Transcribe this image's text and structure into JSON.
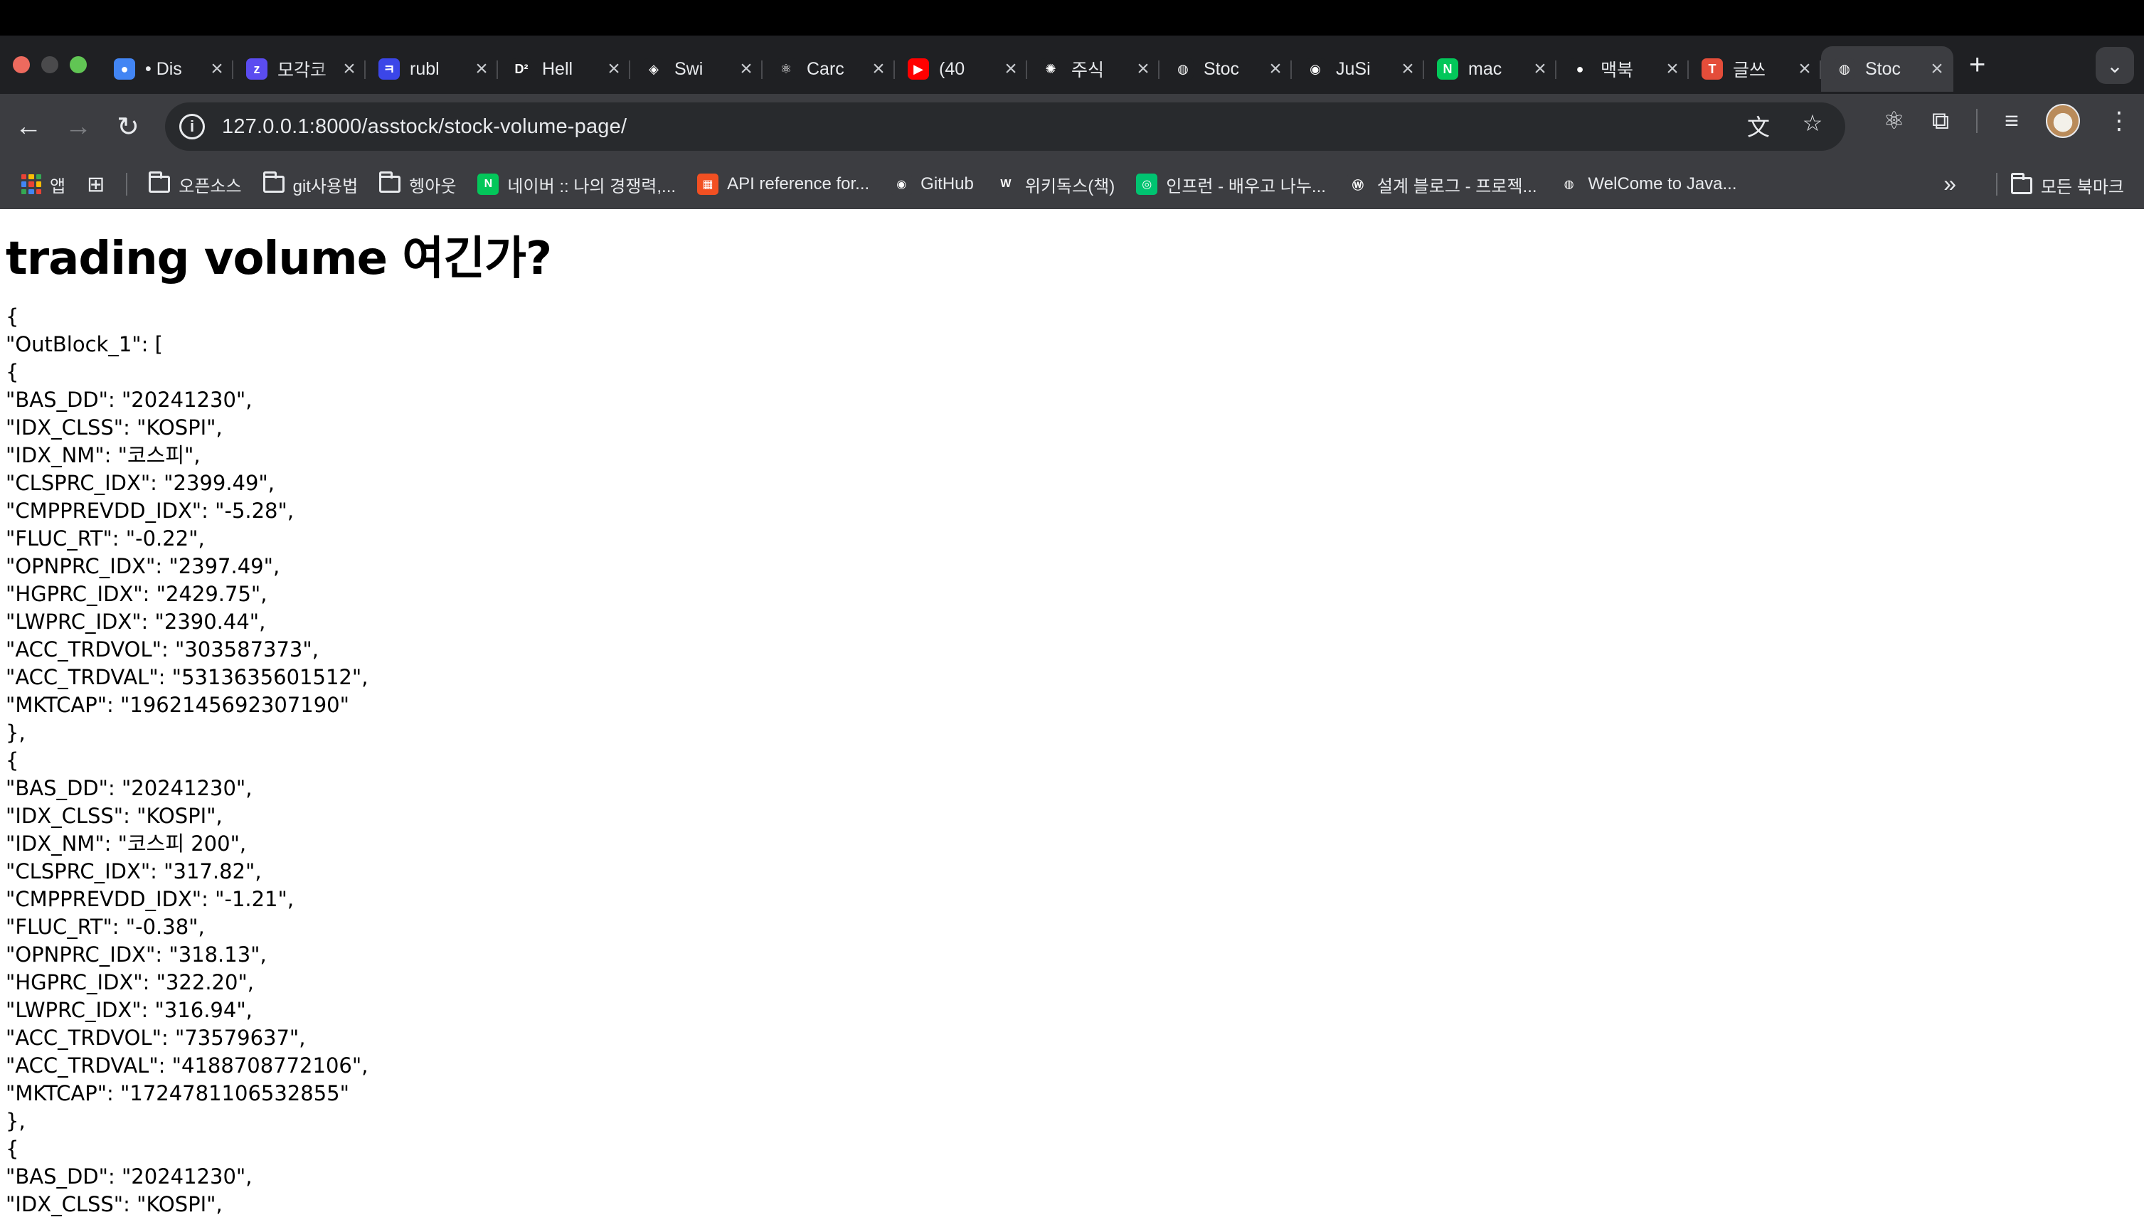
{
  "browser": {
    "tabs": [
      {
        "title": "• Dis",
        "icon": "chrome-icon",
        "color": "#4285f4",
        "glyph": "●"
      },
      {
        "title": "모각코",
        "icon": "zoom-icon",
        "color": "#5b4cf0",
        "glyph": "z"
      },
      {
        "title": "rubl",
        "icon": "rubl-icon",
        "color": "#3b46e8",
        "glyph": "ㅋ"
      },
      {
        "title": "Hell",
        "icon": "d2-icon",
        "color": "#1f2023",
        "glyph": "D²"
      },
      {
        "title": "Swi",
        "icon": "swiper-icon",
        "color": "#1f2023",
        "glyph": "◈"
      },
      {
        "title": "Carc",
        "icon": "react-icon",
        "color": "#1f2023",
        "glyph": "⚛"
      },
      {
        "title": "(40",
        "icon": "youtube-icon",
        "color": "#ff0000",
        "glyph": "▶"
      },
      {
        "title": "주식",
        "icon": "openai-icon",
        "color": "#1f2023",
        "glyph": "✺"
      },
      {
        "title": "Stoc",
        "icon": "globe-icon",
        "color": "#1f2023",
        "glyph": "◍"
      },
      {
        "title": "JuSi",
        "icon": "github-icon",
        "color": "#1f2023",
        "glyph": "◉"
      },
      {
        "title": "mac",
        "icon": "naver-icon",
        "color": "#03c75a",
        "glyph": "N"
      },
      {
        "title": "맥북",
        "icon": "apple-icon",
        "color": "#1f2023",
        "glyph": "●"
      },
      {
        "title": "글쓰",
        "icon": "pin-icon",
        "color": "#e44d3a",
        "glyph": "T"
      },
      {
        "title": "Stoc",
        "icon": "globe-icon",
        "color": "#3c3d41",
        "glyph": "◍",
        "active": true
      }
    ],
    "new_tab": "+",
    "tab_search": "⌄",
    "url": "127.0.0.1:8000/asstock/stock-volume-page/",
    "bookmarks": [
      {
        "label": "앱",
        "type": "apps"
      },
      {
        "label": "",
        "type": "grid"
      },
      {
        "label": "오픈소스",
        "type": "folder"
      },
      {
        "label": "git사용법",
        "type": "folder"
      },
      {
        "label": "헹아웃",
        "type": "folder"
      },
      {
        "label": "네이버 :: 나의 경쟁력,...",
        "type": "site",
        "color": "#03c75a",
        "glyph": "N"
      },
      {
        "label": "API reference for...",
        "type": "site",
        "color": "#f25022",
        "glyph": "▦"
      },
      {
        "label": "GitHub",
        "type": "site",
        "color": "#3c3d41",
        "glyph": "◉"
      },
      {
        "label": "위키독스(책)",
        "type": "site",
        "color": "#3c3d41",
        "glyph": "W"
      },
      {
        "label": "인프런 - 배우고 나누...",
        "type": "site",
        "color": "#00c471",
        "glyph": "◎"
      },
      {
        "label": "설계 블로그 - 프로젝...",
        "type": "site",
        "color": "#3c3d41",
        "glyph": "Ⓦ"
      },
      {
        "label": "WelCome to Java...",
        "type": "site",
        "color": "#3c3d41",
        "glyph": "◍"
      }
    ],
    "all_bookmarks": "모든 북마크"
  },
  "page": {
    "heading": "trading volume 여긴가?",
    "json_lines": [
      "{",
      "\"OutBlock_1\": [",
      "{",
      "\"BAS_DD\": \"20241230\",",
      "\"IDX_CLSS\": \"KOSPI\",",
      "\"IDX_NM\": \"코스피\",",
      "\"CLSPRC_IDX\": \"2399.49\",",
      "\"CMPPREVDD_IDX\": \"-5.28\",",
      "\"FLUC_RT\": \"-0.22\",",
      "\"OPNPRC_IDX\": \"2397.49\",",
      "\"HGPRC_IDX\": \"2429.75\",",
      "\"LWPRC_IDX\": \"2390.44\",",
      "\"ACC_TRDVOL\": \"303587373\",",
      "\"ACC_TRDVAL\": \"5313635601512\",",
      "\"MKTCAP\": \"1962145692307190\"",
      "},",
      "{",
      "\"BAS_DD\": \"20241230\",",
      "\"IDX_CLSS\": \"KOSPI\",",
      "\"IDX_NM\": \"코스피 200\",",
      "\"CLSPRC_IDX\": \"317.82\",",
      "\"CMPPREVDD_IDX\": \"-1.21\",",
      "\"FLUC_RT\": \"-0.38\",",
      "\"OPNPRC_IDX\": \"318.13\",",
      "\"HGPRC_IDX\": \"322.20\",",
      "\"LWPRC_IDX\": \"316.94\",",
      "\"ACC_TRDVOL\": \"73579637\",",
      "\"ACC_TRDVAL\": \"4188708772106\",",
      "\"MKTCAP\": \"1724781106532855\"",
      "},",
      "{",
      "\"BAS_DD\": \"20241230\",",
      "\"IDX_CLSS\": \"KOSPI\","
    ]
  }
}
